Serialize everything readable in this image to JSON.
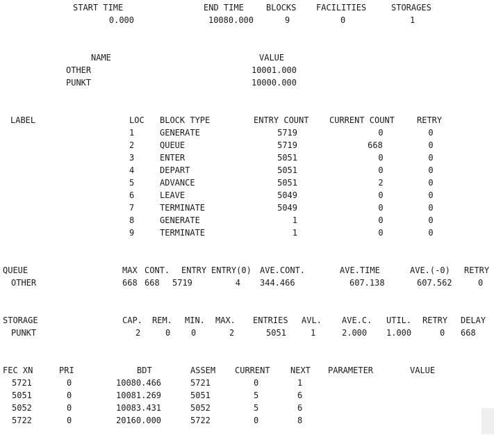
{
  "summary": {
    "headers": {
      "start_time": "START TIME",
      "end_time": "END TIME",
      "blocks": "BLOCKS",
      "facilities": "FACILITIES",
      "storages": "STORAGES"
    },
    "values": {
      "start_time": "0.000",
      "end_time": "10080.000",
      "blocks": "9",
      "facilities": "0",
      "storages": "1"
    }
  },
  "names": {
    "headers": {
      "name": "NAME",
      "value": "VALUE"
    },
    "rows": [
      {
        "name": "OTHER",
        "value": "10001.000"
      },
      {
        "name": "PUNKT",
        "value": "10000.000"
      }
    ]
  },
  "blocks": {
    "headers": {
      "label": "LABEL",
      "loc": "LOC",
      "block_type": "BLOCK TYPE",
      "entry_count": "ENTRY COUNT",
      "current_count": "CURRENT COUNT",
      "retry": "RETRY"
    },
    "rows": [
      {
        "loc": "1",
        "type": "GENERATE",
        "entry": "5719",
        "current": "0",
        "retry": "0"
      },
      {
        "loc": "2",
        "type": "QUEUE",
        "entry": "5719",
        "current": "668",
        "retry": "0"
      },
      {
        "loc": "3",
        "type": "ENTER",
        "entry": "5051",
        "current": "0",
        "retry": "0"
      },
      {
        "loc": "4",
        "type": "DEPART",
        "entry": "5051",
        "current": "0",
        "retry": "0"
      },
      {
        "loc": "5",
        "type": "ADVANCE",
        "entry": "5051",
        "current": "2",
        "retry": "0"
      },
      {
        "loc": "6",
        "type": "LEAVE",
        "entry": "5049",
        "current": "0",
        "retry": "0"
      },
      {
        "loc": "7",
        "type": "TERMINATE",
        "entry": "5049",
        "current": "0",
        "retry": "0"
      },
      {
        "loc": "8",
        "type": "GENERATE",
        "entry": "1",
        "current": "0",
        "retry": "0"
      },
      {
        "loc": "9",
        "type": "TERMINATE",
        "entry": "1",
        "current": "0",
        "retry": "0"
      }
    ]
  },
  "queue": {
    "headers": {
      "queue": "QUEUE",
      "max": "MAX",
      "cont": "CONT.",
      "entry": "ENTRY",
      "entry0": "ENTRY(0)",
      "ave_cont": "AVE.CONT.",
      "ave_time": "AVE.TIME",
      "ave_0": "AVE.(-0)",
      "retry": "RETRY"
    },
    "row": {
      "name": "OTHER",
      "max": "668",
      "cont": "668",
      "entry": "5719",
      "entry0": "4",
      "ave_cont": "344.466",
      "ave_time": "607.138",
      "ave_0": "607.562",
      "retry": "0"
    }
  },
  "storage": {
    "headers": {
      "storage": "STORAGE",
      "cap": "CAP.",
      "rem": "REM.",
      "min": "MIN.",
      "max": "MAX.",
      "entries": "ENTRIES",
      "avl": "AVL.",
      "avec": "AVE.C.",
      "util": "UTIL.",
      "retry": "RETRY",
      "delay": "DELAY"
    },
    "row": {
      "name": "PUNKT",
      "cap": "2",
      "rem": "0",
      "min": "0",
      "max": "2",
      "entries": "5051",
      "avl": "1",
      "avec": "2.000",
      "util": "1.000",
      "retry": "0",
      "delay": "668"
    }
  },
  "fec": {
    "headers": {
      "fec_xn": "FEC XN",
      "pri": "PRI",
      "bdt": "BDT",
      "assem": "ASSEM",
      "current": "CURRENT",
      "next": "NEXT",
      "parameter": "PARAMETER",
      "value": "VALUE"
    },
    "rows": [
      {
        "xn": "5721",
        "pri": "0",
        "bdt": "10080.466",
        "assem": "5721",
        "current": "0",
        "next": "1"
      },
      {
        "xn": "5051",
        "pri": "0",
        "bdt": "10081.269",
        "assem": "5051",
        "current": "5",
        "next": "6"
      },
      {
        "xn": "5052",
        "pri": "0",
        "bdt": "10083.431",
        "assem": "5052",
        "current": "5",
        "next": "6"
      },
      {
        "xn": "5722",
        "pri": "0",
        "bdt": "20160.000",
        "assem": "5722",
        "current": "0",
        "next": "8"
      }
    ]
  }
}
